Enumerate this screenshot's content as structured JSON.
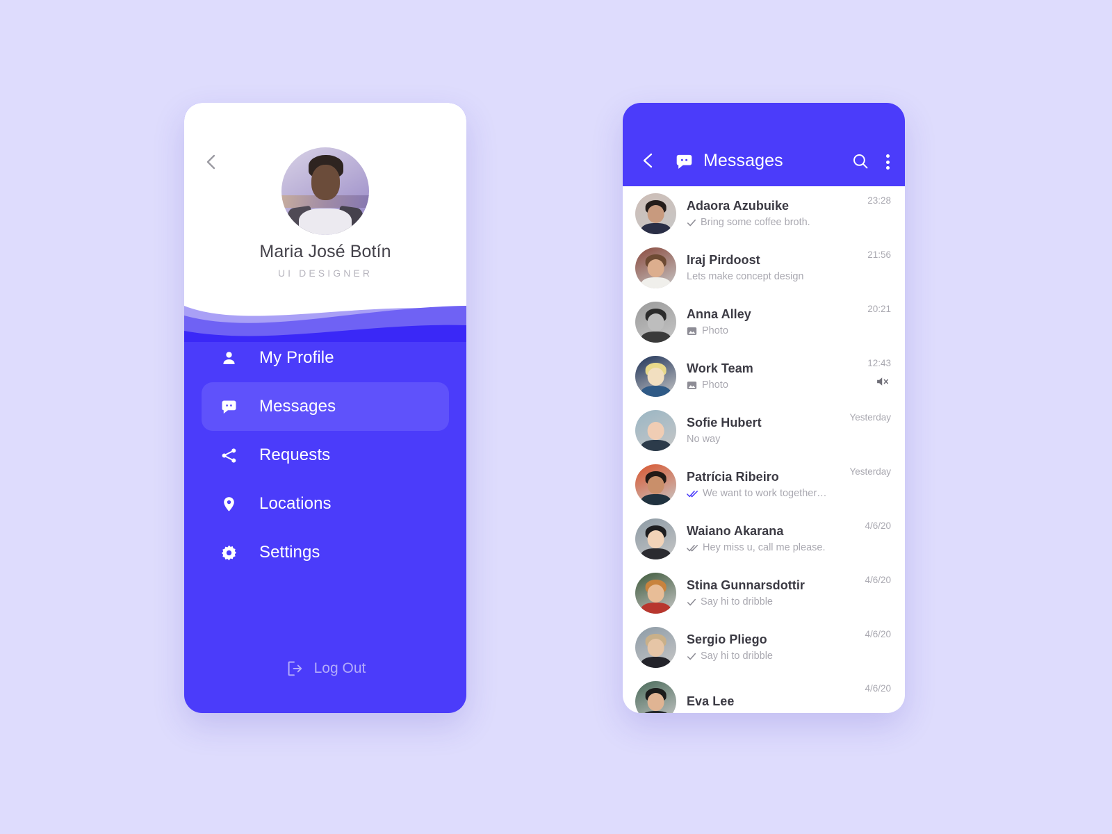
{
  "theme": {
    "page_bg": "#dedcfd",
    "primary": "#4b3cfa",
    "active_pill": "#5f52fb",
    "read_tick": "#4b3cfa",
    "muted_text": "#a9a8b0",
    "name_text": "#3b3a43"
  },
  "profile": {
    "back_icon": "chevron-left-icon",
    "avatar": "user-avatar-photo",
    "name": "Maria José Botín",
    "role": "UI DESIGNER",
    "menu": [
      {
        "label": "My Profile",
        "icon": "person-icon",
        "active": false
      },
      {
        "label": "Messages",
        "icon": "chat-bubble-icon",
        "active": true
      },
      {
        "label": "Requests",
        "icon": "share-icon",
        "active": false
      },
      {
        "label": "Locations",
        "icon": "map-pin-icon",
        "active": false
      },
      {
        "label": "Settings",
        "icon": "gear-icon",
        "active": false
      }
    ],
    "logout": {
      "label": "Log Out",
      "icon": "logout-icon"
    }
  },
  "messages": {
    "header": {
      "back_icon": "chevron-left-icon",
      "chat_icon": "chat-bubble-icon",
      "title": "Messages",
      "search_icon": "search-icon",
      "menu_icon": "kebab-menu-icon"
    },
    "conversations": [
      {
        "name": "Adaora Azubuike",
        "preview": "Bring some coffee broth.",
        "time": "23:28",
        "status": "sent",
        "attachment": "none",
        "muted": false,
        "avatar": {
          "bg": "#cdbdb6",
          "hair": "#241c1a",
          "skin": "#c89a7e",
          "body": "#2a2e46"
        }
      },
      {
        "name": "Iraj Pirdoost",
        "preview": "Lets make concept design",
        "time": "21:56",
        "status": "none",
        "attachment": "none",
        "muted": false,
        "avatar": {
          "bg": "#8a4a3e",
          "hair": "#6d4a33",
          "skin": "#dcae8e",
          "body": "#f0efeb"
        }
      },
      {
        "name": "Anna Alley",
        "preview": "Photo",
        "time": "20:21",
        "status": "none",
        "attachment": "photo",
        "muted": false,
        "avatar": {
          "bg": "#9a9a9a",
          "hair": "#2b2b2b",
          "skin": "#bdbdbd",
          "body": "#3a3a3a"
        }
      },
      {
        "name": "Work Team",
        "preview": "Photo",
        "time": "12:43",
        "status": "none",
        "attachment": "photo",
        "muted": true,
        "avatar": {
          "bg": "#1f3358",
          "hair": "#e8d98a",
          "skin": "#f2dfc0",
          "body": "#2f5a86"
        }
      },
      {
        "name": "Sofie Hubert",
        "preview": "No way",
        "time": "Yesterday",
        "status": "none",
        "attachment": "none",
        "muted": false,
        "avatar": {
          "bg": "#9ab6c4",
          "hair": "#b2estub",
          "skin": "#f0cdb4",
          "body": "#2c3b4a"
        }
      },
      {
        "name": "Patrícia Ribeiro",
        "preview": "We want to work together…",
        "time": "Yesterday",
        "status": "read",
        "attachment": "none",
        "muted": false,
        "avatar": {
          "bg": "#d9552e",
          "hair": "#231a16",
          "skin": "#c98f6a",
          "body": "#20323f"
        }
      },
      {
        "name": "Waiano Akarana",
        "preview": "Hey miss u, call me please.",
        "time": "4/6/20",
        "status": "delivered",
        "attachment": "none",
        "muted": false,
        "avatar": {
          "bg": "#8c9aa4",
          "hair": "#1d1d1f",
          "skin": "#f2d3b8",
          "body": "#2b2b30"
        }
      },
      {
        "name": "Stina Gunnarsdottir",
        "preview": "Say hi to dribble",
        "time": "4/6/20",
        "status": "sent",
        "attachment": "none",
        "muted": false,
        "avatar": {
          "bg": "#3f5a3c",
          "hair": "#c8833d",
          "skin": "#e8bd97",
          "body": "#b8372e"
        }
      },
      {
        "name": "Sergio Pliego",
        "preview": "Say hi to dribble",
        "time": "4/6/20",
        "status": "sent",
        "attachment": "none",
        "muted": false,
        "avatar": {
          "bg": "#8d9ba6",
          "hair": "#c9b089",
          "skin": "#e6c5a6",
          "body": "#23232a"
        }
      },
      {
        "name": "Eva Lee",
        "preview": "",
        "time": "4/6/20",
        "status": "none",
        "attachment": "none",
        "muted": false,
        "avatar": {
          "bg": "#4a6b5a",
          "hair": "#1b1b1b",
          "skin": "#e0b493",
          "body": "#262a2e"
        }
      }
    ]
  }
}
